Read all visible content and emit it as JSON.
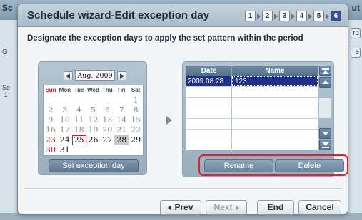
{
  "background": {
    "left_tab": "Sc",
    "right_tab": "ut",
    "left_label1": "G",
    "left_label2": "Se",
    "left_label3": "1",
    "right_btn1": "rd",
    "right_btn2": "e"
  },
  "dialog": {
    "title": "Schedule wizard-Edit exception day",
    "steps": [
      "1",
      "2",
      "3",
      "4",
      "5",
      "6"
    ],
    "active_step": "6",
    "instruction": "Designate the exception days to apply the set pattern within the period"
  },
  "calendar": {
    "month_label": "Aug, 2009",
    "weekdays": [
      "Sun",
      "Mon",
      "Tue",
      "Wed",
      "Thu",
      "Fri",
      "Sat"
    ],
    "weeks": [
      [
        "",
        "",
        "",
        "",
        "",
        "",
        "1"
      ],
      [
        "2",
        "3",
        "4",
        "5",
        "6",
        "7",
        "8"
      ],
      [
        "9",
        "10",
        "11",
        "12",
        "13",
        "14",
        "15"
      ],
      [
        "16",
        "17",
        "18",
        "19",
        "20",
        "21",
        "22"
      ],
      [
        "23",
        "24",
        "25",
        "26",
        "27",
        "28",
        "29"
      ],
      [
        "30",
        "31",
        "",
        "",
        "",
        "",
        ""
      ]
    ],
    "selected_day": "25",
    "exception_day": "28",
    "set_button": "Set exception day"
  },
  "exception_list": {
    "columns": [
      "Date",
      "Name"
    ],
    "rows": [
      {
        "date": "2009.08.28",
        "name": "123"
      }
    ],
    "rename_button": "Rename",
    "delete_button": "Delete"
  },
  "footer": {
    "prev": "Prev",
    "next": "Next",
    "end": "End",
    "cancel": "Cancel"
  }
}
